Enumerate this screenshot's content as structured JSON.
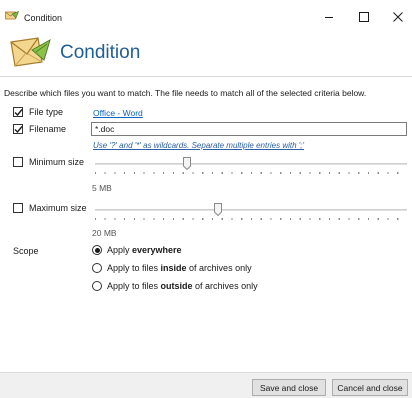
{
  "window": {
    "title": "Condition",
    "controls": [
      "minimize",
      "maximize",
      "close"
    ]
  },
  "header": {
    "title": "Condition",
    "icon": "condition-icon"
  },
  "description": "Describe which files you want to match. The file needs to match all of the selected criteria below.",
  "criteria": {
    "file_type": {
      "label": "File type",
      "checked": true,
      "value": "Office - Word"
    },
    "filename": {
      "label": "Filename",
      "checked": true,
      "value": "*.doc",
      "hint": "Use '?' and '*' as wildcards. Separate multiple entries with ';'"
    },
    "minimum_size": {
      "label": "Minimum size",
      "checked": false,
      "value": "5 MB",
      "slider_fraction": 0.29
    },
    "maximum_size": {
      "label": "Maximum size",
      "checked": false,
      "value": "20 MB",
      "slider_fraction": 0.39
    }
  },
  "scope": {
    "label": "Scope",
    "options": [
      {
        "prefix": "Apply ",
        "bold": "everywhere",
        "suffix": "",
        "selected": true
      },
      {
        "prefix": "Apply to files ",
        "bold": "inside",
        "suffix": " of archives only",
        "selected": false
      },
      {
        "prefix": "Apply to files ",
        "bold": "outside",
        "suffix": " of archives only",
        "selected": false
      }
    ]
  },
  "footer": {
    "save_label": "Save and close",
    "cancel_label": "Cancel and close"
  }
}
